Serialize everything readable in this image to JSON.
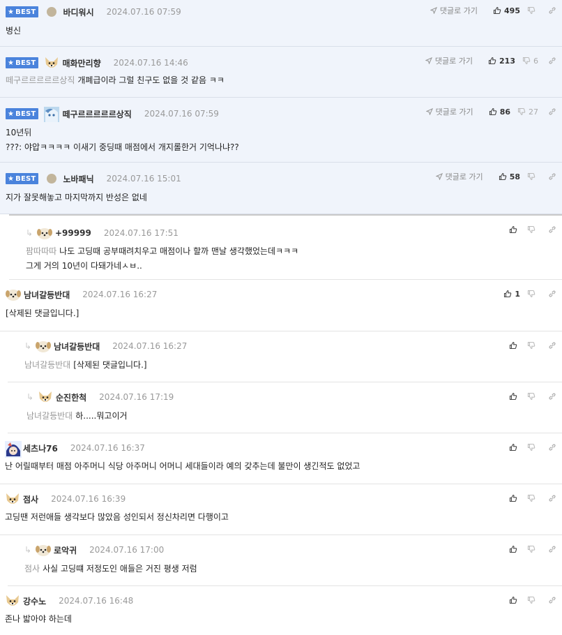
{
  "labels": {
    "best": "BEST",
    "goto_reply": "댓글로 가기"
  },
  "comments": [
    {
      "nick": "바디워시",
      "date": "2024.07.16 07:59",
      "lines": [
        "병신"
      ],
      "likes": "495",
      "dislikes": ""
    },
    {
      "nick": "매화만리향",
      "date": "2024.07.16 14:46",
      "mention": "떼구르르르르르상직",
      "lines": [
        "개폐급이라 그럴 친구도 없을 것 같음 ㅋㅋ"
      ],
      "likes": "213",
      "dislikes": "6"
    },
    {
      "nick": "떼구르르르르르상직",
      "date": "2024.07.16 07:59",
      "lines": [
        "10년뒤",
        "???: 야압ㅋㅋㅋㅋ 이새기 중딩때 매점에서 개지롤한거 기억나냐??"
      ],
      "likes": "86",
      "dislikes": "27"
    },
    {
      "nick": "노바패닉",
      "date": "2024.07.16 15:01",
      "lines": [
        "지가 잘못해놓고 마지막까지 반성은 없네"
      ],
      "likes": "58",
      "dislikes": ""
    },
    {
      "nick": "+99999",
      "date": "2024.07.16 17:51",
      "mention": "팜따따따",
      "lines": [
        "나도 고딩때 공부때려치우고 매점이나 할까 맨날 생각했었는데ㅋㅋㅋ",
        "그게 거의 10년이 다돼가네ㅅㅂ.."
      ],
      "likes": "",
      "dislikes": ""
    },
    {
      "nick": "남녀갈등반대",
      "date": "2024.07.16 16:27",
      "lines": [
        "[삭제된 댓글입니다.]"
      ],
      "likes": "1",
      "dislikes": ""
    },
    {
      "nick": "남녀갈등반대",
      "date": "2024.07.16 16:27",
      "mention": "남녀갈등반대",
      "lines": [
        "[삭제된 댓글입니다.]"
      ],
      "likes": "",
      "dislikes": ""
    },
    {
      "nick": "순진한척",
      "date": "2024.07.16 17:19",
      "mention": "남녀갈등반대",
      "lines": [
        "하.....뭐고이거"
      ],
      "likes": "",
      "dislikes": ""
    },
    {
      "nick": "세츠나76",
      "date": "2024.07.16 16:37",
      "lines": [
        "난 어릴때부터 매점 아주머니 식당 아주머니 어머니 세대들이라 예의 갖추는데 불만이 생긴적도 없었고"
      ],
      "likes": "",
      "dislikes": ""
    },
    {
      "nick": "점사",
      "date": "2024.07.16 16:39",
      "lines": [
        "고딩땐 저런애들 생각보다 많았음 성인되서 정신차리면 다행이고"
      ],
      "likes": "",
      "dislikes": ""
    },
    {
      "nick": "로악귀",
      "date": "2024.07.16 17:00",
      "mention": "점사",
      "lines": [
        "사실 고딩떄 저정도인 애들은 거진 평생 저럼"
      ],
      "likes": "",
      "dislikes": ""
    },
    {
      "nick": "강수노",
      "date": "2024.07.16 16:48",
      "lines": [
        "존나 밟아야 하는데"
      ],
      "likes": "",
      "dislikes": ""
    }
  ]
}
